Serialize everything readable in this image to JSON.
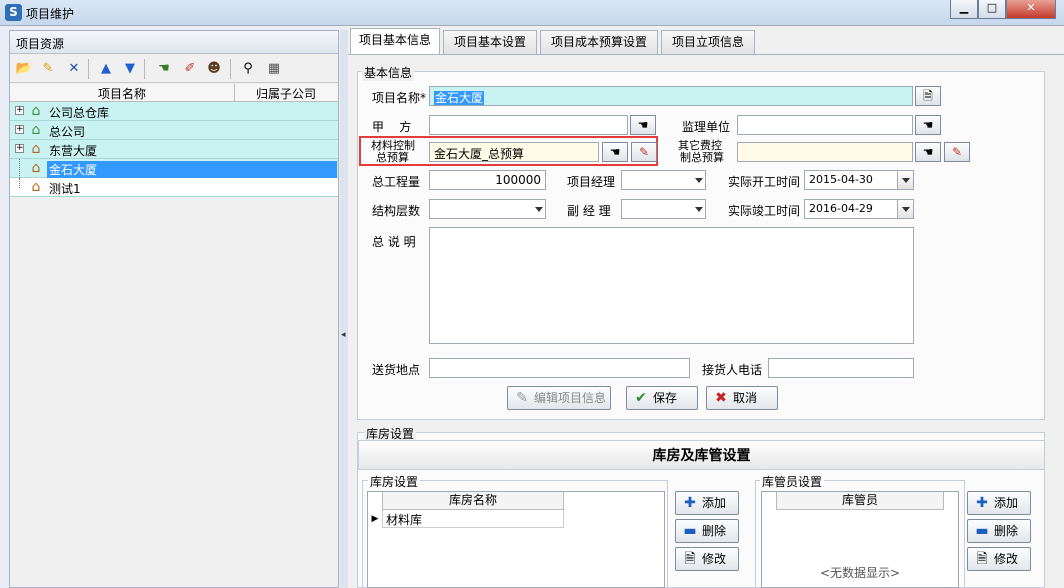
{
  "window": {
    "title": "项目维护"
  },
  "left": {
    "title": "项目资源",
    "columns": [
      "项目名称",
      "归属子公司"
    ],
    "tree": [
      {
        "label": "公司总仓库",
        "expander": "+",
        "icon": "house-green-icon"
      },
      {
        "label": "总公司",
        "expander": "+",
        "icon": "house-green-icon"
      },
      {
        "label": "东营大厦",
        "expander": "+",
        "icon": "house-icon"
      },
      {
        "label": "金石大厦",
        "expander": "",
        "icon": "house-icon"
      },
      {
        "label": "测试1",
        "expander": "",
        "icon": "house-icon"
      }
    ]
  },
  "tabs": [
    "项目基本信息",
    "项目基本设置",
    "项目成本预算设置",
    "项目立项信息"
  ],
  "basic": {
    "group_label": "基本信息",
    "name_label": "项目名称*",
    "name_value": "金石大厦",
    "party_a_label": "甲    方",
    "supervisor_label": "监理单位",
    "material_label_1": "材料控制",
    "material_label_2": "总预算",
    "material_value": "金石大厦_总预算",
    "other_label_1": "其它费控",
    "other_label_2": "制总预算",
    "total_label": "总工程量",
    "total_value": "100000",
    "manager_label": "项目经理",
    "start_label": "实际开工时间",
    "start_value": "2015-04-30",
    "structure_label": "结构层数",
    "deputy_label": "副 经 理",
    "finish_label": "实际竣工时间",
    "finish_value": "2016-04-29",
    "desc_label": "总 说 明",
    "address_label": "送货地点",
    "phone_label": "接货人电话"
  },
  "buttons": {
    "edit": "编辑项目信息",
    "save": "保存",
    "cancel": "取消"
  },
  "warehouse": {
    "section_label": "库房设置",
    "header": "库房及库管设置",
    "rooms_label": "库房设置",
    "rooms_col": "库房名称",
    "rooms": [
      "材料库"
    ],
    "keepers_label": "库管员设置",
    "keepers_col": "库管员",
    "empty": "<无数据显示>",
    "add": "添加",
    "delete": "删除",
    "modify": "修改"
  },
  "colors": {
    "highlight": "#e23c3c",
    "tree_row": "#c9f2f2",
    "selection": "#3399ff"
  }
}
